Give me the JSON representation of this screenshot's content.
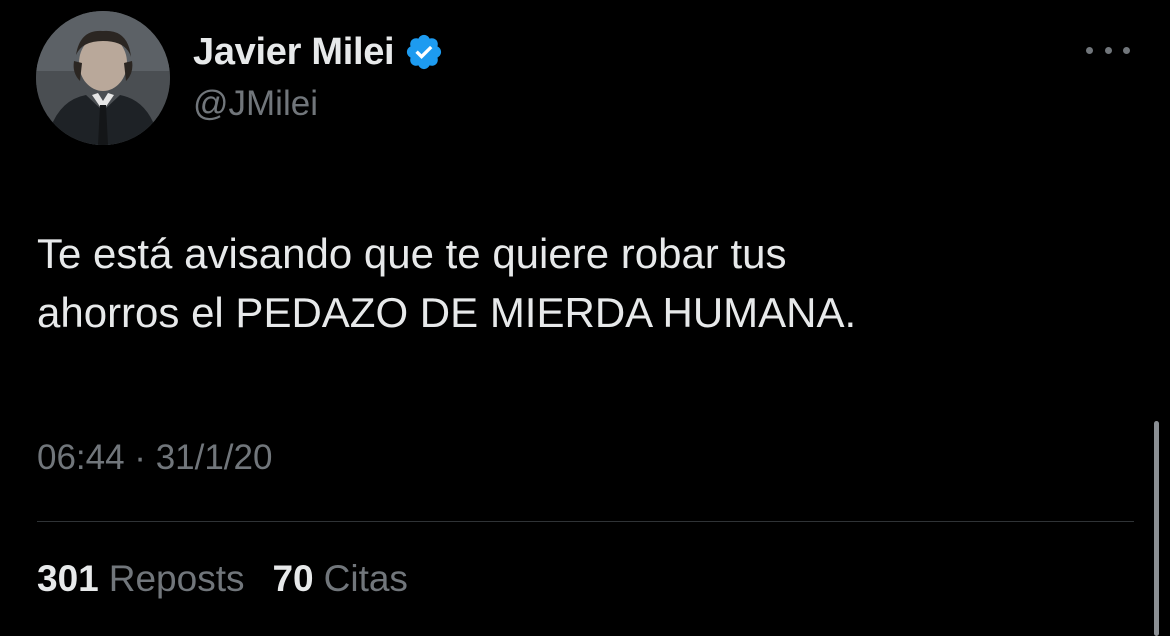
{
  "author": {
    "display_name": "Javier Milei",
    "handle": "@JMilei",
    "verified": true
  },
  "tweet": {
    "text": "Te está avisando que te quiere robar tus\nahorros el PEDAZO DE MIERDA HUMANA.",
    "timestamp": "06:44 · 31/1/20"
  },
  "stats": {
    "reposts_count": "301",
    "reposts_label": "Reposts",
    "quotes_count": "70",
    "quotes_label": "Citas"
  },
  "icons": {
    "verified": "verified-badge-icon",
    "more": "more-horizontal-icon"
  },
  "colors": {
    "background": "#000000",
    "primary_text": "#e7e9ea",
    "secondary_text": "#71767b",
    "verified_blue": "#1d9bf0",
    "divider": "#2f3336"
  }
}
